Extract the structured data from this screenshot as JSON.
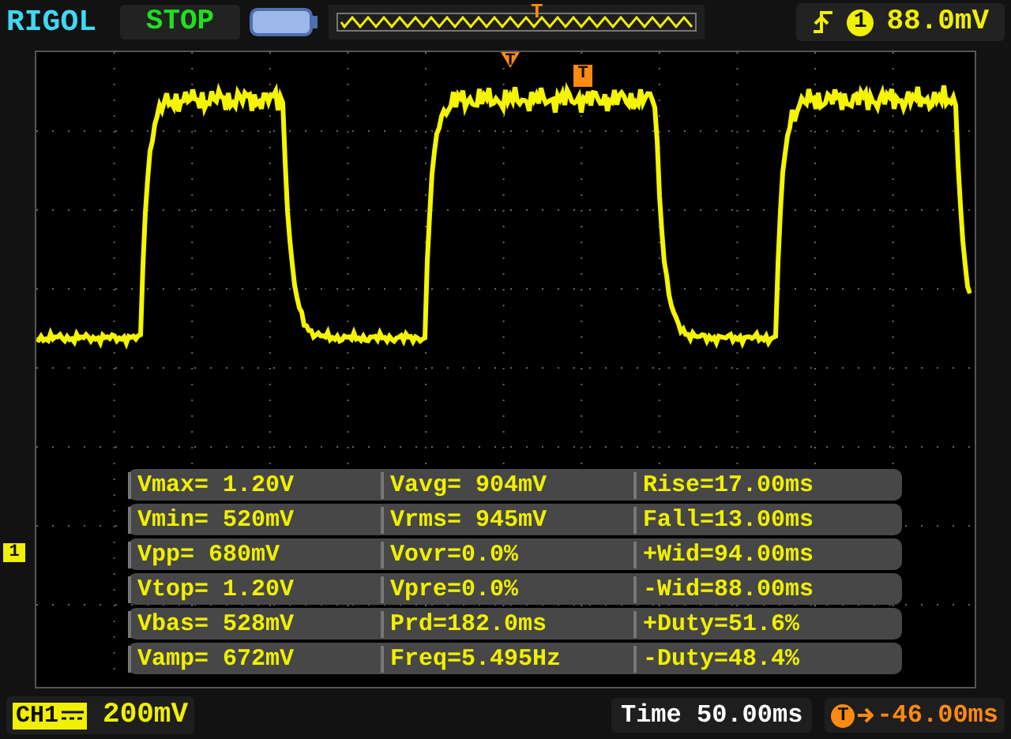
{
  "header": {
    "brand": "RIGOL",
    "run_state": "STOP",
    "memory_trigger_marker": "T",
    "trigger": {
      "source": "1",
      "level": "88.0mV"
    }
  },
  "screen": {
    "trigger_position_marker": "T",
    "waveform_trigger_marker": "T",
    "channel_marker": "1",
    "measurements": [
      [
        "Vmax= 1.20V",
        "Vavg= 904mV",
        "Rise=17.00ms"
      ],
      [
        "Vmin= 520mV",
        "Vrms= 945mV",
        "Fall=13.00ms"
      ],
      [
        "Vpp= 680mV",
        "Vovr=0.0%",
        "+Wid=94.00ms"
      ],
      [
        "Vtop= 1.20V",
        "Vpre=0.0%",
        "-Wid=88.00ms"
      ],
      [
        "Vbas= 528mV",
        "Prd=182.0ms",
        "+Duty=51.6%"
      ],
      [
        "Vamp= 672mV",
        "Freq=5.495Hz",
        "-Duty=48.4%"
      ]
    ]
  },
  "footer": {
    "channel": "CH1",
    "scale": "200mV",
    "timebase": "Time 50.00ms",
    "offset_marker": "T",
    "trigger_offset": "-46.00ms"
  }
}
